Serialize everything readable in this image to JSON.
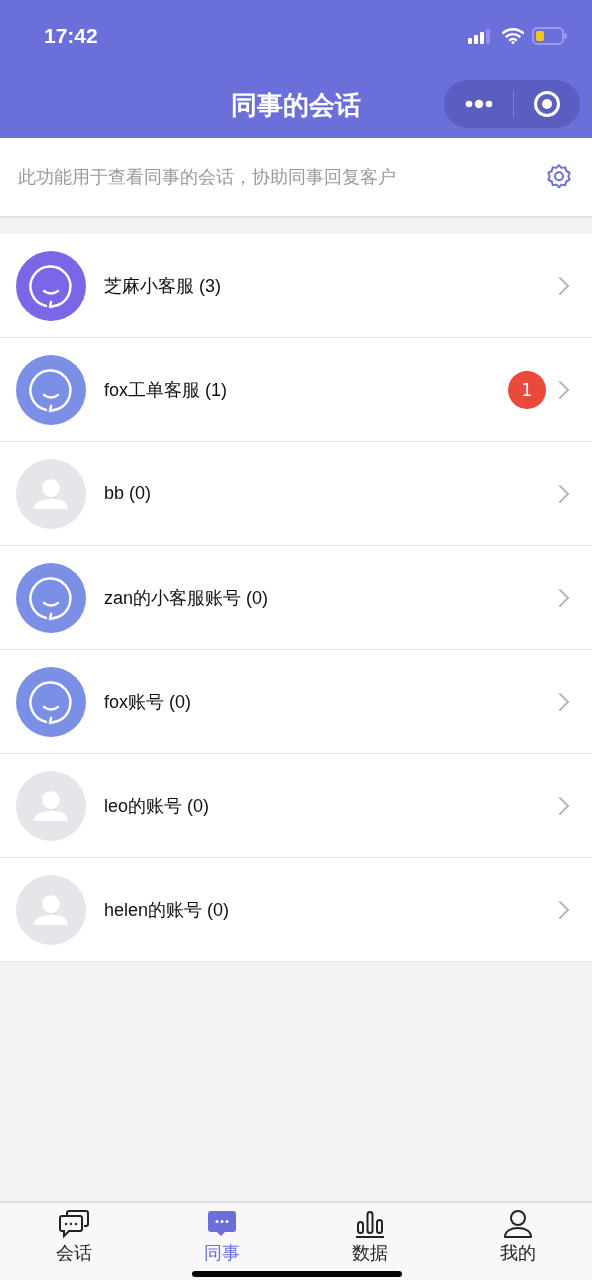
{
  "status_bar": {
    "time": "17:42"
  },
  "header": {
    "title": "同事的会话"
  },
  "notice": {
    "text": "此功能用于查看同事的会话，协助同事回复客户"
  },
  "colleagues": [
    {
      "name": "芝麻小客服 (3)",
      "kind": "bot",
      "color": "#7a66e6"
    },
    {
      "name": "fox工单客服 (1)",
      "kind": "bot",
      "color": "#7b8fe6",
      "badge": "1"
    },
    {
      "name": "bb (0)",
      "kind": "person"
    },
    {
      "name": "zan的小客服账号 (0)",
      "kind": "bot",
      "color": "#7b8fe6"
    },
    {
      "name": "fox账号 (0)",
      "kind": "bot",
      "color": "#7b8fe6"
    },
    {
      "name": "leo的账号 (0)",
      "kind": "person"
    },
    {
      "name": "helen的账号 (0)",
      "kind": "person"
    }
  ],
  "tabs": [
    {
      "label": "会话",
      "selected": false
    },
    {
      "label": "同事",
      "selected": true
    },
    {
      "label": "数据",
      "selected": false
    },
    {
      "label": "我的",
      "selected": false
    }
  ]
}
